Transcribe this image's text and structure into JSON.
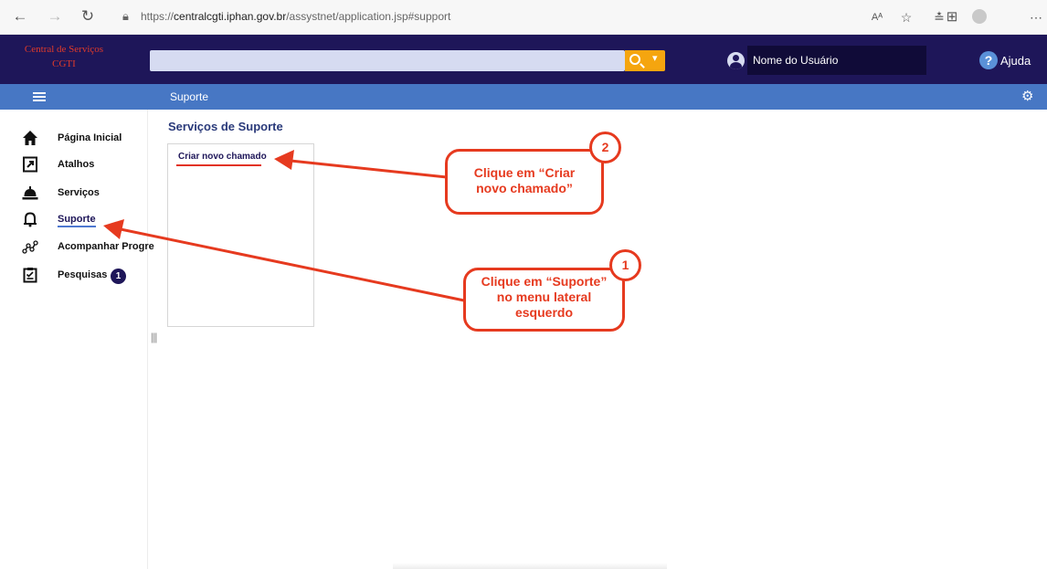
{
  "browser": {
    "url_prefix": "https://",
    "url_host": "centralcgti.iphan.gov.br",
    "url_path": "/assystnet/application.jsp#support",
    "icons": [
      "back-icon",
      "forward-icon",
      "refresh-icon",
      "lock-icon",
      "read-aloud-icon",
      "favorite-icon",
      "favorites-icon",
      "collections-icon",
      "profile-icon",
      "more-icon"
    ],
    "read_aloud": "Aᴬ"
  },
  "header": {
    "brand_line1": "Central de Serviços",
    "brand_line2": "CGTI",
    "search_value": "",
    "user_name": "Nome do Usuário",
    "help_label": "Ajuda",
    "help_icon_glyph": "?",
    "colors": {
      "header_bg": "#1e1659",
      "search_btn": "#f5a50f",
      "brand": "#e03a2a"
    }
  },
  "navbar": {
    "breadcrumb": "Suporte",
    "colors": {
      "bg": "#4777c4"
    }
  },
  "sidebar": {
    "items": [
      {
        "label": "Página Inicial",
        "icon": "home-icon"
      },
      {
        "label": "Atalhos",
        "icon": "shortcut-icon"
      },
      {
        "label": "Serviços",
        "icon": "service-bell-icon"
      },
      {
        "label": "Suporte",
        "icon": "support-bell-icon",
        "active": true
      },
      {
        "label": "Acompanhar Progre",
        "icon": "progress-icon"
      },
      {
        "label": "Pesquisas",
        "icon": "survey-icon",
        "badge": "1"
      }
    ],
    "resize_handle": "|||"
  },
  "main": {
    "title": "Serviços de Suporte",
    "services": [
      {
        "label": "Criar novo chamado"
      }
    ]
  },
  "annotations": {
    "callout_2": {
      "step": "2",
      "line1": "Clique em “Criar",
      "line2": "novo chamado”"
    },
    "callout_1": {
      "step": "1",
      "line1": "Clique em “Suporte”",
      "line2": "no menu lateral",
      "line3": "esquerdo"
    },
    "color": "#e63a1f"
  }
}
